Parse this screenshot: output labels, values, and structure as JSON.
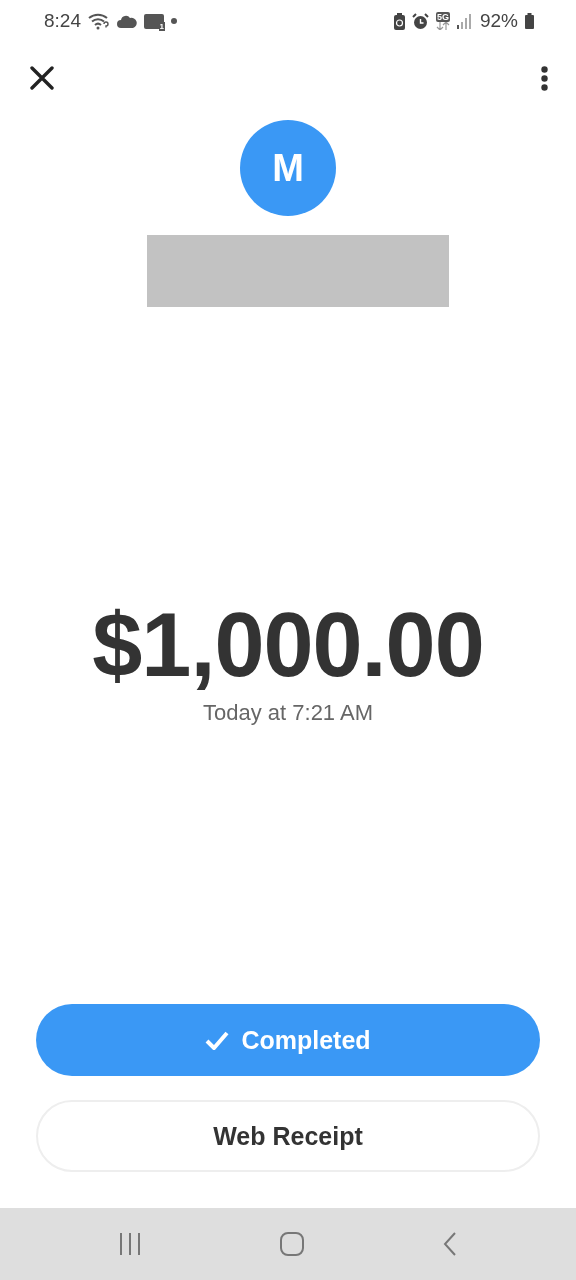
{
  "status_bar": {
    "time": "8:24",
    "voicemail_count": "1",
    "network": "5G",
    "battery": "92%"
  },
  "header": {
    "avatar_initial": "M"
  },
  "payment": {
    "amount": "$1,000.00",
    "time": "Today at 7:21 AM"
  },
  "buttons": [
    {
      "kind": "status",
      "label": "Completed"
    },
    {
      "kind": "outline",
      "label": "Web Receipt"
    }
  ]
}
